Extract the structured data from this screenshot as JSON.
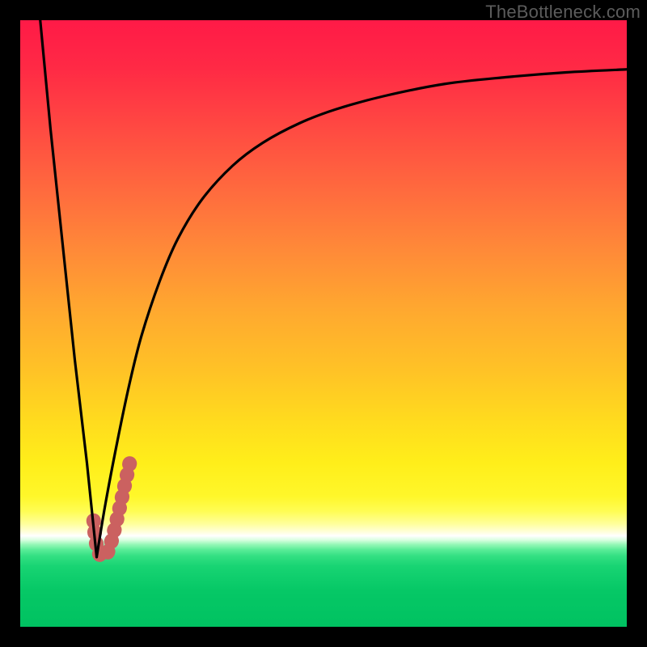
{
  "watermark": {
    "text": "TheBottleneck.com"
  },
  "colors": {
    "frame": "#000000",
    "curve": "#000000",
    "marker": "#cb6160",
    "gradient_top": "#ff1a47",
    "gradient_bottom": "#00c261"
  },
  "chart_data": {
    "type": "line",
    "title": "",
    "xlabel": "",
    "ylabel": "",
    "xlim": [
      0,
      100
    ],
    "ylim": [
      0,
      100
    ],
    "grid": false,
    "legend": false,
    "series": [
      {
        "name": "left-branch",
        "comment": "Steep descending segment from upper-left edge to the notch near bottom",
        "x": [
          3.3,
          5.0,
          7.0,
          9.0,
          11.0,
          12.6
        ],
        "y": [
          100,
          82,
          63,
          44,
          27,
          11.5
        ]
      },
      {
        "name": "right-branch",
        "comment": "Rising curve from the notch, steep then flattening toward upper-right",
        "x": [
          12.6,
          14.0,
          16.0,
          18.0,
          20.0,
          23.0,
          26.0,
          30.0,
          35.0,
          40.0,
          46.0,
          52.0,
          60.0,
          70.0,
          80.0,
          90.0,
          100.0
        ],
        "y": [
          11.5,
          20.0,
          30.5,
          40.0,
          48.0,
          57.0,
          64.0,
          70.5,
          76.0,
          79.8,
          83.0,
          85.3,
          87.5,
          89.5,
          90.6,
          91.4,
          91.9
        ]
      }
    ],
    "marker": {
      "comment": "Short thick salmon J-shaped highlight near the notch",
      "points": [
        {
          "x": 12.1,
          "y": 17.5
        },
        {
          "x": 12.4,
          "y": 14.5
        },
        {
          "x": 12.9,
          "y": 12.3
        },
        {
          "x": 13.6,
          "y": 11.6
        },
        {
          "x": 14.6,
          "y": 12.7
        },
        {
          "x": 15.9,
          "y": 17.5
        },
        {
          "x": 17.6,
          "y": 25.0
        },
        {
          "x": 18.4,
          "y": 28.5
        }
      ]
    }
  }
}
